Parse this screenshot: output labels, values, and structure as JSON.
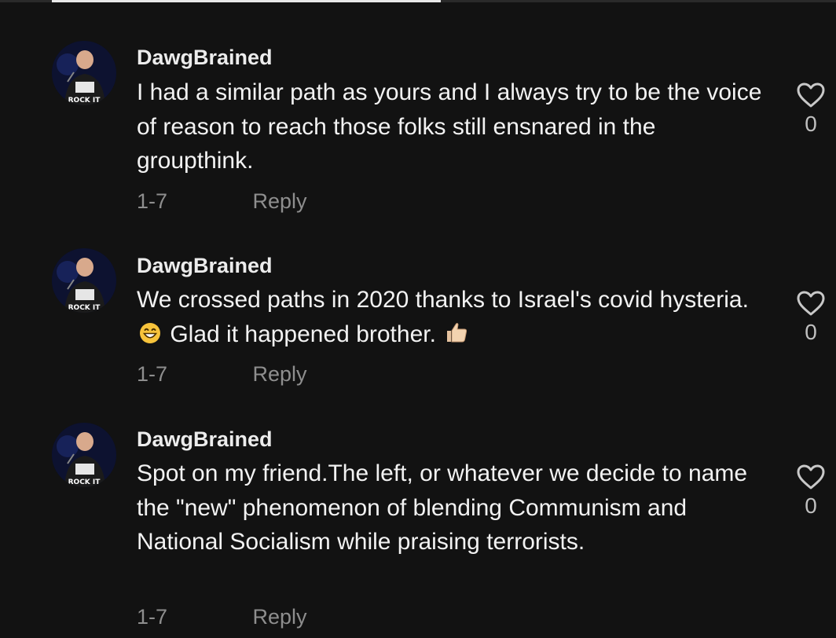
{
  "comments": [
    {
      "username": "DawgBrained",
      "text_parts": [
        "I had a similar path as yours and I always try to be the voice of reason to reach those folks still ensnared in the groupthink."
      ],
      "date": "1-7",
      "reply_label": "Reply",
      "like_count": "0"
    },
    {
      "username": "DawgBrained",
      "text_parts": [
        "We crossed paths in 2020 thanks to Israel's covid hysteria.",
        "Glad it happened brother."
      ],
      "date": "1-7",
      "reply_label": "Reply",
      "like_count": "0"
    },
    {
      "username": "DawgBrained",
      "text_parts": [
        "Spot on my friend.The left, or whatever we decide to name the \"new\" phenomenon of blending Communism and National Socialism while praising terrorists."
      ],
      "date": "1-7",
      "reply_label": "Reply",
      "like_count": "0"
    }
  ],
  "icons": {
    "like": "heart-outline-icon",
    "emoji_grin": "grinning-face-icon",
    "emoji_thumbs": "thumbs-up-icon"
  },
  "colors": {
    "background": "#121212",
    "text": "#f2f2f2",
    "meta": "#8e8e8e"
  }
}
